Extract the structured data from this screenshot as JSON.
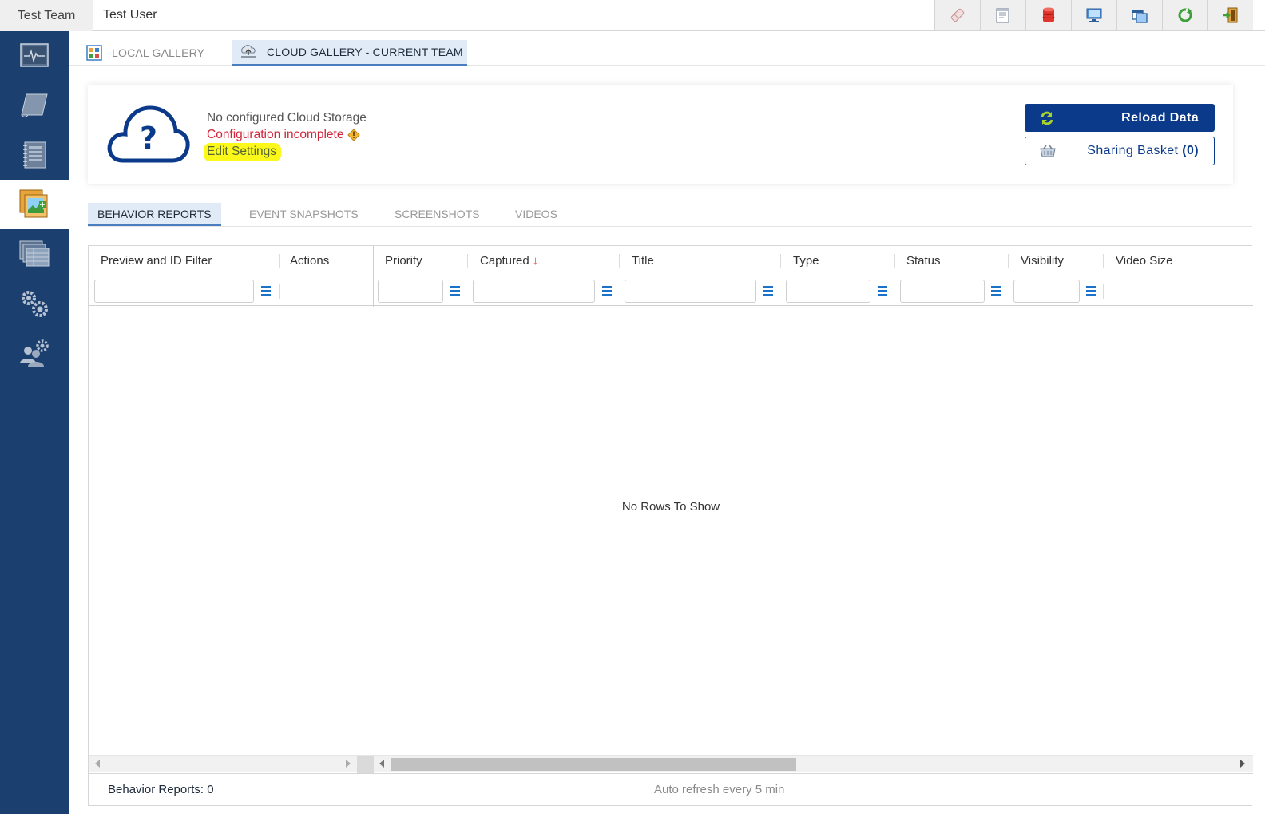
{
  "topbar": {
    "team": "Test Team",
    "user": "Test User",
    "icons": [
      "eraser-icon",
      "notes-icon",
      "database-icon",
      "monitor-icon",
      "windows-icon",
      "refresh-icon",
      "exit-icon"
    ]
  },
  "sidebar": {
    "items": [
      "activity-monitor-icon",
      "scroll-icon",
      "notebook-icon",
      "gallery-icon",
      "data-grid-icon",
      "settings-gears-icon",
      "user-settings-icon"
    ],
    "active": "gallery-icon"
  },
  "gallery_tabs": [
    {
      "label": "LOCAL GALLERY"
    },
    {
      "label": "CLOUD GALLERY - CURRENT TEAM"
    }
  ],
  "storage": {
    "message": "No configured Cloud Storage",
    "warning": "Configuration incomplete",
    "edit_link": "Edit Settings"
  },
  "buttons": {
    "reload": "Reload Data",
    "basket_label": "Sharing Basket",
    "basket_count": "(0)"
  },
  "subtabs": [
    {
      "label": "BEHAVIOR REPORTS"
    },
    {
      "label": "EVENT SNAPSHOTS"
    },
    {
      "label": "SCREENSHOTS"
    },
    {
      "label": "VIDEOS"
    }
  ],
  "grid": {
    "columns": [
      "Preview and ID Filter",
      "Actions",
      "Priority",
      "Captured",
      "Title",
      "Type",
      "Status",
      "Visibility",
      "Video Size"
    ],
    "sort_column": "Captured",
    "empty_message": "No Rows To Show"
  },
  "status": {
    "count": "Behavior Reports: 0",
    "refresh": "Auto refresh every 5 min"
  },
  "colors": {
    "sidebar": "#1b3f6e",
    "primary_button": "#0b3a8a",
    "warning_text": "#d0253a",
    "highlight": "#fbf81a",
    "active_tab": "#e1ebf7"
  }
}
